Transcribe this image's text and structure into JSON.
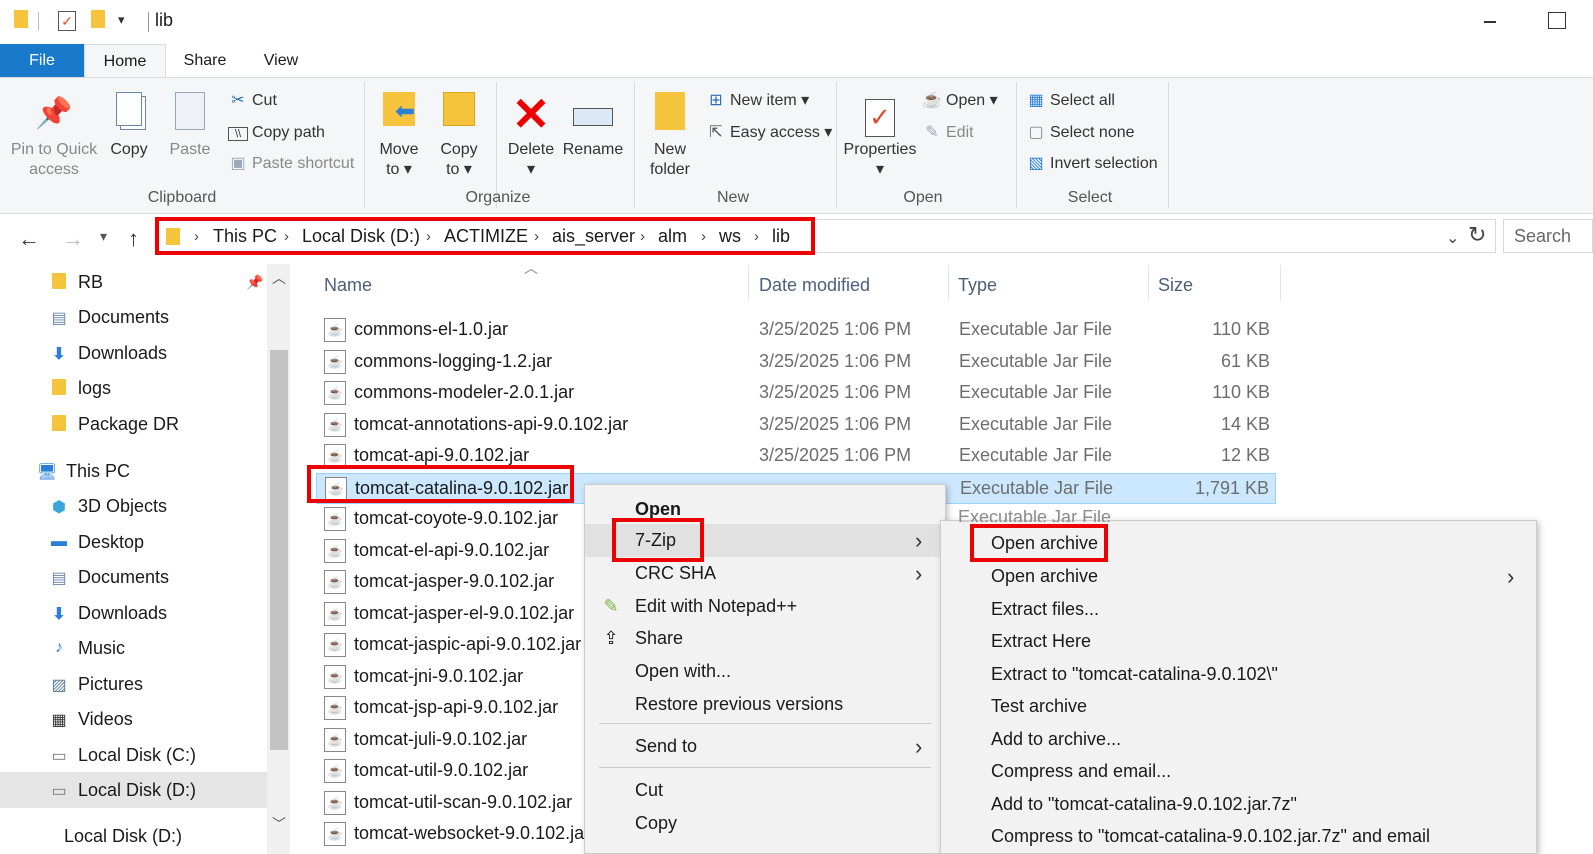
{
  "window": {
    "title": "lib"
  },
  "ribbon": {
    "tabs": [
      "File",
      "Home",
      "Share",
      "View"
    ],
    "clipboard": {
      "pin_line1": "Pin to Quick",
      "pin_line2": "access",
      "copy": "Copy",
      "paste": "Paste",
      "cut": "Cut",
      "copy_path": "Copy path",
      "paste_shortcut": "Paste shortcut",
      "label": "Clipboard"
    },
    "organize": {
      "move_line1": "Move",
      "move_line2": "to",
      "copy_line1": "Copy",
      "copy_line2": "to",
      "delete": "Delete",
      "rename": "Rename",
      "label": "Organize"
    },
    "new": {
      "folder_line1": "New",
      "folder_line2": "folder",
      "new_item": "New item",
      "easy_access": "Easy access",
      "label": "New"
    },
    "open": {
      "properties": "Properties",
      "open": "Open",
      "edit": "Edit",
      "label": "Open"
    },
    "select": {
      "select_all": "Select all",
      "select_none": "Select none",
      "invert": "Invert selection",
      "label": "Select"
    }
  },
  "address": {
    "crumbs": [
      "This PC",
      "Local Disk (D:)",
      "ACTIMIZE",
      "ais_server",
      "alm",
      "ws",
      "lib"
    ],
    "search_placeholder": "Search"
  },
  "nav_pane": {
    "items": [
      "RB",
      "Documents",
      "Downloads",
      "logs",
      "Package DR",
      "This PC",
      "3D Objects",
      "Desktop",
      "Documents",
      "Downloads",
      "Music",
      "Pictures",
      "Videos",
      "Local Disk (C:)",
      "Local Disk (D:)",
      "Local Disk (D:)"
    ]
  },
  "columns": {
    "name": "Name",
    "date": "Date modified",
    "type": "Type",
    "size": "Size"
  },
  "files": [
    {
      "name": "commons-el-1.0.jar",
      "date": "3/25/2025 1:06 PM",
      "type": "Executable Jar File",
      "size": "110 KB"
    },
    {
      "name": "commons-logging-1.2.jar",
      "date": "3/25/2025 1:06 PM",
      "type": "Executable Jar File",
      "size": "61 KB"
    },
    {
      "name": "commons-modeler-2.0.1.jar",
      "date": "3/25/2025 1:06 PM",
      "type": "Executable Jar File",
      "size": "110 KB"
    },
    {
      "name": "tomcat-annotations-api-9.0.102.jar",
      "date": "3/25/2025 1:06 PM",
      "type": "Executable Jar File",
      "size": "14 KB"
    },
    {
      "name": "tomcat-api-9.0.102.jar",
      "date": "3/25/2025 1:06 PM",
      "type": "Executable Jar File",
      "size": "12 KB"
    },
    {
      "name": "tomcat-catalina-9.0.102.jar",
      "date": "",
      "type": "Executable Jar File",
      "size": "1,791 KB"
    },
    {
      "name": "tomcat-coyote-9.0.102.jar",
      "date": "",
      "type": "",
      "size": ""
    },
    {
      "name": "tomcat-el-api-9.0.102.jar",
      "date": "",
      "type": "",
      "size": ""
    },
    {
      "name": "tomcat-jasper-9.0.102.jar",
      "date": "",
      "type": "",
      "size": ""
    },
    {
      "name": "tomcat-jasper-el-9.0.102.jar",
      "date": "",
      "type": "",
      "size": ""
    },
    {
      "name": "tomcat-jaspic-api-9.0.102.jar",
      "date": "",
      "type": "",
      "size": ""
    },
    {
      "name": "tomcat-jni-9.0.102.jar",
      "date": "",
      "type": "",
      "size": ""
    },
    {
      "name": "tomcat-jsp-api-9.0.102.jar",
      "date": "",
      "type": "",
      "size": ""
    },
    {
      "name": "tomcat-juli-9.0.102.jar",
      "date": "",
      "type": "",
      "size": ""
    },
    {
      "name": "tomcat-util-9.0.102.jar",
      "date": "",
      "type": "",
      "size": ""
    },
    {
      "name": "tomcat-util-scan-9.0.102.jar",
      "date": "",
      "type": "",
      "size": ""
    },
    {
      "name": "tomcat-websocket-9.0.102.jar",
      "date": "",
      "type": "",
      "size": ""
    }
  ],
  "context_menu": {
    "items": [
      "Open",
      "7-Zip",
      "CRC SHA",
      "Edit with Notepad++",
      "Share",
      "Open with...",
      "Restore previous versions",
      "Send to",
      "Cut",
      "Copy"
    ]
  },
  "submenu": {
    "items": [
      "Open archive",
      "Open archive",
      "Extract files...",
      "Extract Here",
      "Extract to \"tomcat-catalina-9.0.102\\\"",
      "Test archive",
      "Add to archive...",
      "Compress and email...",
      "Add to \"tomcat-catalina-9.0.102.jar.7z\"",
      "Compress to \"tomcat-catalina-9.0.102.jar.7z\" and email"
    ]
  },
  "colors": {
    "accent": "#1979ca",
    "highlight": "#e00000",
    "selection": "#cce8ff"
  }
}
